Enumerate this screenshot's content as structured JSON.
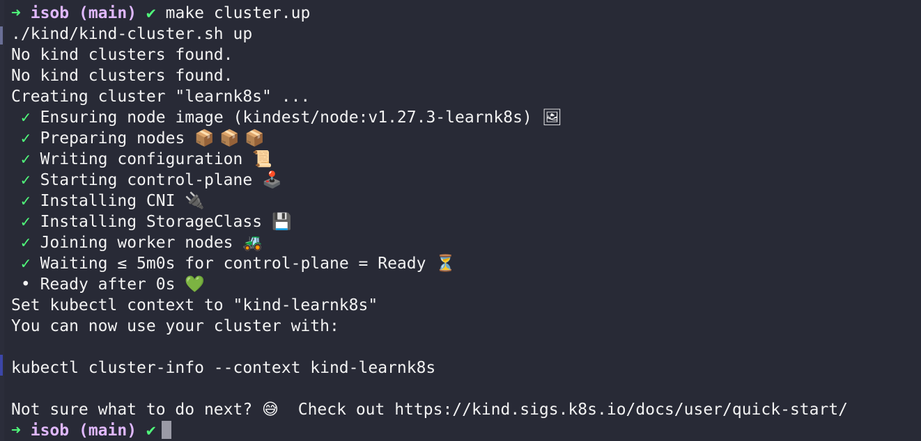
{
  "terminal": {
    "prompt1": {
      "arrow": "➜",
      "user": "isob",
      "branch": "(main)",
      "check": "✔",
      "command": "make cluster.up"
    },
    "lines": {
      "script": "./kind/kind-cluster.sh up",
      "no_clusters_1": "No kind clusters found.",
      "no_clusters_2": "No kind clusters found.",
      "creating": "Creating cluster \"learnk8s\" ..."
    },
    "steps": [
      {
        "mark": "✓",
        "text": "Ensuring node image (kindest/node:v1.27.3-learnk8s)",
        "emoji": "🖼"
      },
      {
        "mark": "✓",
        "text": "Preparing nodes",
        "emoji": "📦 📦 📦"
      },
      {
        "mark": "✓",
        "text": "Writing configuration",
        "emoji": "📜"
      },
      {
        "mark": "✓",
        "text": "Starting control-plane",
        "emoji": "🕹️"
      },
      {
        "mark": "✓",
        "text": "Installing CNI",
        "emoji": "🔌"
      },
      {
        "mark": "✓",
        "text": "Installing StorageClass",
        "emoji": "💾"
      },
      {
        "mark": "✓",
        "text": "Joining worker nodes",
        "emoji": "🚜"
      },
      {
        "mark": "✓",
        "text": "Waiting ≤ 5m0s for control-plane = Ready",
        "emoji": "⏳"
      },
      {
        "mark": "•",
        "text": "Ready after 0s",
        "emoji": "💚"
      }
    ],
    "after": {
      "context": "Set kubectl context to \"kind-learnk8s\"",
      "use_cluster": "You can now use your cluster with:",
      "cluster_info": "kubectl cluster-info --context kind-learnk8s",
      "not_sure": "Not sure what to do next?",
      "not_sure_emoji": "😅",
      "check_out": " Check out https://kind.sigs.k8s.io/docs/user/quick-start/"
    },
    "prompt2": {
      "arrow": "➜",
      "user": "isob",
      "branch": "(main)",
      "check": "✔"
    },
    "colors": {
      "background": "#282a36",
      "prompt_green": "#50fa7b",
      "prompt_purple": "#e0b8ff",
      "text": "#f2f2f2"
    }
  }
}
